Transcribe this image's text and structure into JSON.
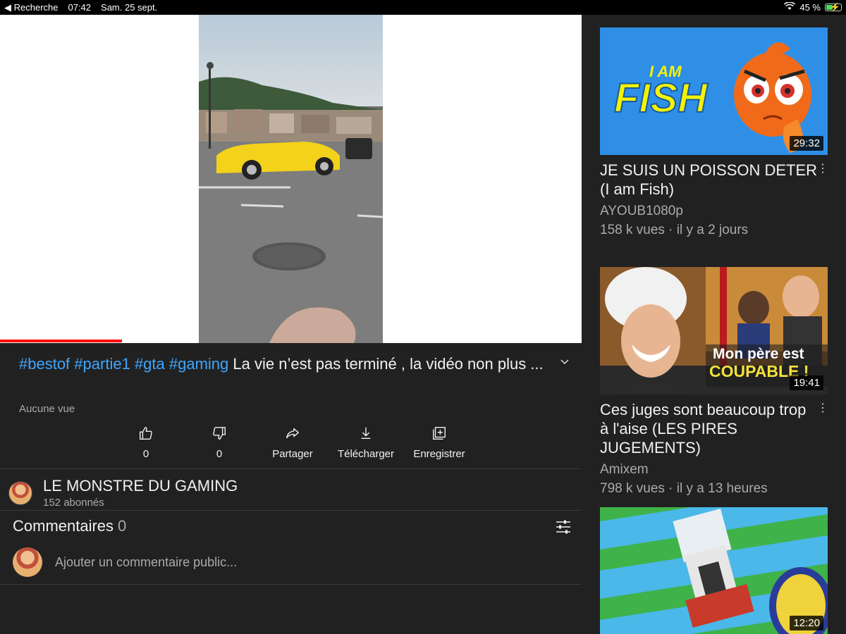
{
  "statusbar": {
    "back": "◀ Recherche",
    "time": "07:42",
    "date": "Sam. 25 sept.",
    "battery": "45 %",
    "battery_level": 0.45
  },
  "video": {
    "progress": 0.21,
    "description_hashtags": [
      "#bestof",
      "#partie1",
      "#gta",
      "#gaming"
    ],
    "description_text": "La vie n’est pas terminé  , la vidéo non plus ...",
    "views": "Aucune vue"
  },
  "actions": [
    {
      "icon": "thumb-up-icon",
      "label": "0"
    },
    {
      "icon": "thumb-down-icon",
      "label": "0"
    },
    {
      "icon": "share-icon",
      "label": "Partager"
    },
    {
      "icon": "download-icon",
      "label": "Télécharger"
    },
    {
      "icon": "save-icon",
      "label": "Enregistrer"
    }
  ],
  "channel": {
    "name": "LE MONSTRE DU GAMING",
    "subscribers": "152 abonnés"
  },
  "comments": {
    "title": "Commentaires",
    "count": "0",
    "placeholder": "Ajouter un commentaire public..."
  },
  "recommendations": [
    {
      "duration": "29:32",
      "title": "JE SUIS UN POISSON DETER (I am Fish)",
      "channel": "AYOUB1080p",
      "meta": "158 k vues · il y a 2 jours",
      "thumb_text_1": "I AM",
      "thumb_text_2": "FISH"
    },
    {
      "duration": "19:41",
      "title": "Ces juges sont beaucoup trop à l'aise (LES PIRES JUGEMENTS)",
      "channel": "Amixem",
      "meta": "798 k vues · il y a 13 heures",
      "thumb_text_1": "Mon père est",
      "thumb_text_2": "COUPABLE !"
    },
    {
      "duration": "12:20"
    }
  ]
}
